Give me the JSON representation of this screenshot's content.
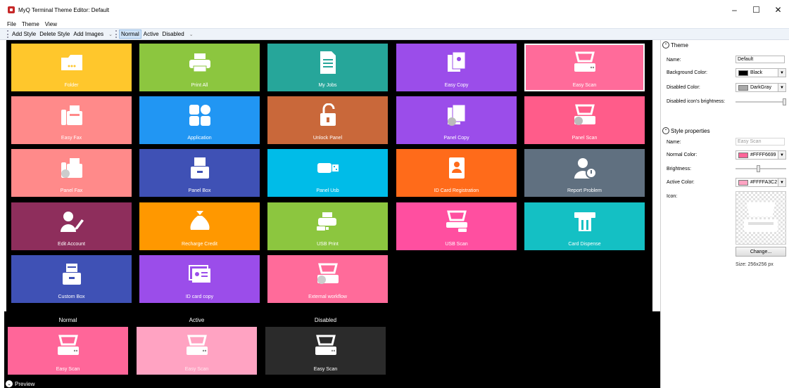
{
  "window": {
    "title": "MyQ Terminal Theme Editor: Default",
    "controls": {
      "minimize": "–",
      "maximize": "☐",
      "close": "✕"
    }
  },
  "menu": [
    "File",
    "Theme",
    "View"
  ],
  "toolbar": {
    "add_style": "Add Style",
    "delete_style": "Delete Style",
    "add_images": "Add Images",
    "normal": "Normal",
    "active": "Active",
    "disabled": "Disabled"
  },
  "tiles": [
    {
      "label": "Folder",
      "color": "#FFC72C",
      "icon": "folder-icon"
    },
    {
      "label": "Print All",
      "color": "#8CC63F",
      "icon": "printer-icon"
    },
    {
      "label": "My Jobs",
      "color": "#26A69A",
      "icon": "document-icon"
    },
    {
      "label": "Easy Copy",
      "color": "#9B4DEA",
      "icon": "copy-icon"
    },
    {
      "label": "Easy Scan",
      "color": "#FF6B9A",
      "icon": "scanner-icon"
    },
    {
      "label": "Easy Fax",
      "color": "#FF8A8A",
      "icon": "fax-icon"
    },
    {
      "label": "Application",
      "color": "#2196F3",
      "icon": "app-grid-icon"
    },
    {
      "label": "Unlock Panel",
      "color": "#C9683A",
      "icon": "unlock-icon"
    },
    {
      "label": "Panel Copy",
      "color": "#9B4DEA",
      "icon": "panel-copy-icon"
    },
    {
      "label": "Panel Scan",
      "color": "#FF5C8A",
      "icon": "panel-scan-icon"
    },
    {
      "label": "Panel Fax",
      "color": "#FF8A8A",
      "icon": "panel-fax-icon"
    },
    {
      "label": "Panel Box",
      "color": "#3F51B5",
      "icon": "box-icon"
    },
    {
      "label": "Panel Usb",
      "color": "#00BCE8",
      "icon": "usb-icon"
    },
    {
      "label": "ID Card Registration",
      "color": "#FF6B1A",
      "icon": "id-card-icon"
    },
    {
      "label": "Report Problem",
      "color": "#607080",
      "icon": "support-agent-icon"
    },
    {
      "label": "Edit Account",
      "color": "#8E2E5C",
      "icon": "edit-user-icon"
    },
    {
      "label": "Recharge Credit",
      "color": "#FF9800",
      "icon": "money-bag-icon"
    },
    {
      "label": "USB Print",
      "color": "#8CC63F",
      "icon": "usb-print-icon"
    },
    {
      "label": "USB Scan",
      "color": "#FF4FA0",
      "icon": "usb-scan-icon"
    },
    {
      "label": "Card Dispense",
      "color": "#14C0C4",
      "icon": "card-dispense-icon"
    },
    {
      "label": "Custom Box",
      "color": "#3F51B5",
      "icon": "custom-box-icon"
    },
    {
      "label": "ID card copy",
      "color": "#9B4DEA",
      "icon": "id-copy-icon"
    },
    {
      "label": "External workflow",
      "color": "#FF6B9A",
      "icon": "workflow-icon"
    }
  ],
  "preview": {
    "normal_header": "Normal",
    "active_header": "Active",
    "disabled_header": "Disabled",
    "normal_color": "#FF6699",
    "active_color": "#FFA3C2",
    "disabled_color": "#2B2B2B",
    "tile_label": "Easy Scan",
    "footer": "Preview"
  },
  "panel": {
    "theme_header": "Theme",
    "name_label": "Name:",
    "name_value": "Default",
    "bg_label": "Background Color:",
    "bg_value": "Black",
    "bg_swatch": "#000000",
    "disabled_label": "Disabled Color:",
    "disabled_value": "DarkGray",
    "disabled_swatch": "#A9A9A9",
    "brightness_label": "Disabled icon's brightness:",
    "brightness_level": 1.0,
    "style_header": "Style properties",
    "style_name_label": "Name:",
    "style_name_value": "Easy Scan",
    "normal_color_label": "Normal Color:",
    "normal_color_value": "#FFFF6699",
    "normal_swatch": "#FF6699",
    "brightness2_label": "Brightness:",
    "brightness2_level": 0.45,
    "active_color_label": "Active Color:",
    "active_color_value": "#FFFFA3C2",
    "active_swatch": "#FFA3C2",
    "icon_label": "Icon:",
    "change_button": "Change...",
    "size_text": "Size: 256x256 px"
  }
}
